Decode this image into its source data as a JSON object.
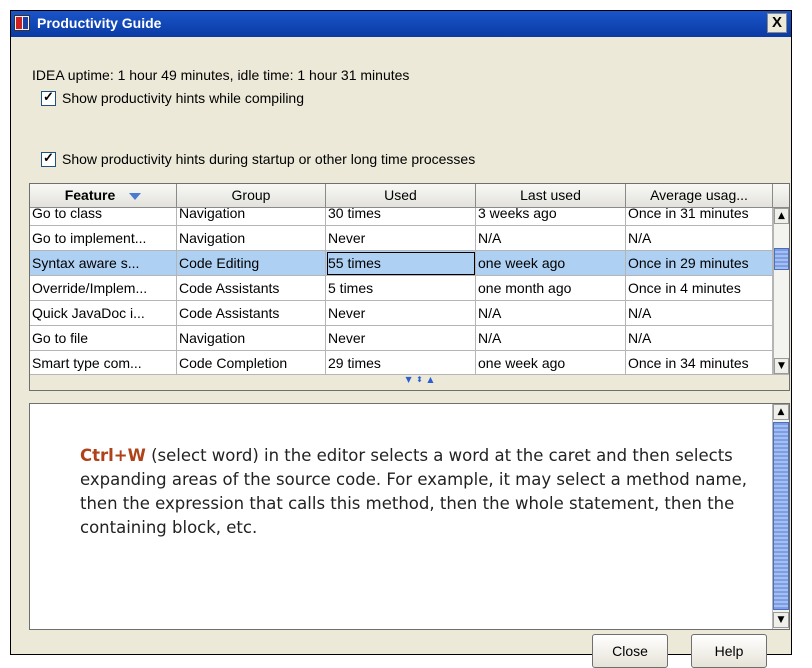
{
  "window": {
    "title": "Productivity Guide",
    "close_glyph": "X"
  },
  "uptime_text": "IDEA uptime: 1 hour 49 minutes, idle time: 1 hour 31 minutes",
  "checkboxes": [
    {
      "label": "Show productivity hints while compiling",
      "checked": true
    },
    {
      "label": "Show productivity hints during startup or other long time processes",
      "checked": true
    }
  ],
  "table": {
    "columns": [
      "Feature",
      "Group",
      "Used",
      "Last used",
      "Average usag..."
    ],
    "sorted_column": "Feature",
    "rows": [
      {
        "feature": "Go to class",
        "group": "Navigation",
        "used": "30 times",
        "last_used": "3 weeks ago",
        "average": "Once in 31 minutes",
        "selected": false
      },
      {
        "feature": "Go to implement...",
        "group": "Navigation",
        "used": "Never",
        "last_used": "N/A",
        "average": "N/A",
        "selected": false
      },
      {
        "feature": "Syntax aware s...",
        "group": "Code Editing",
        "used": "55 times",
        "last_used": "one week ago",
        "average": "Once in 29 minutes",
        "selected": true
      },
      {
        "feature": "Override/Implem...",
        "group": "Code Assistants",
        "used": "5 times",
        "last_used": "one month ago",
        "average": "Once in 4 minutes",
        "selected": false
      },
      {
        "feature": "Quick JavaDoc i...",
        "group": "Code Assistants",
        "used": "Never",
        "last_used": "N/A",
        "average": "N/A",
        "selected": false
      },
      {
        "feature": "Go to file",
        "group": "Navigation",
        "used": "Never",
        "last_used": "N/A",
        "average": "N/A",
        "selected": false
      },
      {
        "feature": "Smart type com...",
        "group": "Code Completion",
        "used": "29 times",
        "last_used": "one week ago",
        "average": "Once in 34 minutes",
        "selected": false
      }
    ]
  },
  "hint": {
    "shortcut": "Ctrl+W",
    "body": " (select word) in the editor selects a word at the caret and then selects expanding areas of the source code. For example, it may select a method name, then the expression that calls this method, then the whole statement, then the containing block, etc."
  },
  "buttons": {
    "close": "Close",
    "help": "Help"
  },
  "colors": {
    "titlebar": "#0a3aa5",
    "selection": "#aed0f3",
    "shortcut": "#b0421a",
    "dialog_bg": "#ece9d8"
  },
  "icons": {
    "app": "intellij-idea-icon",
    "sort": "sort-descending-icon",
    "scroll_up": "scroll-up-arrow-icon",
    "scroll_down": "scroll-down-arrow-icon"
  }
}
